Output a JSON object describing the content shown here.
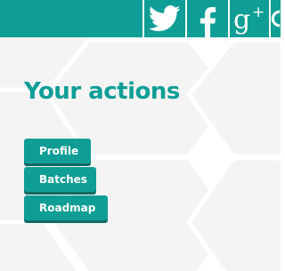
{
  "header": {
    "social_icons": [
      "twitter-icon",
      "facebook-icon",
      "google-plus-icon",
      "social-icon"
    ],
    "google_plus_glyph": "g",
    "google_plus_sup": "+"
  },
  "actions": {
    "title": "Your actions",
    "buttons": [
      "Profile",
      "Batches",
      "Roadmap"
    ]
  },
  "colors": {
    "accent": "#0e9e95",
    "button_shadow": "#126a64",
    "hex_pattern": "#f4f4f4"
  }
}
